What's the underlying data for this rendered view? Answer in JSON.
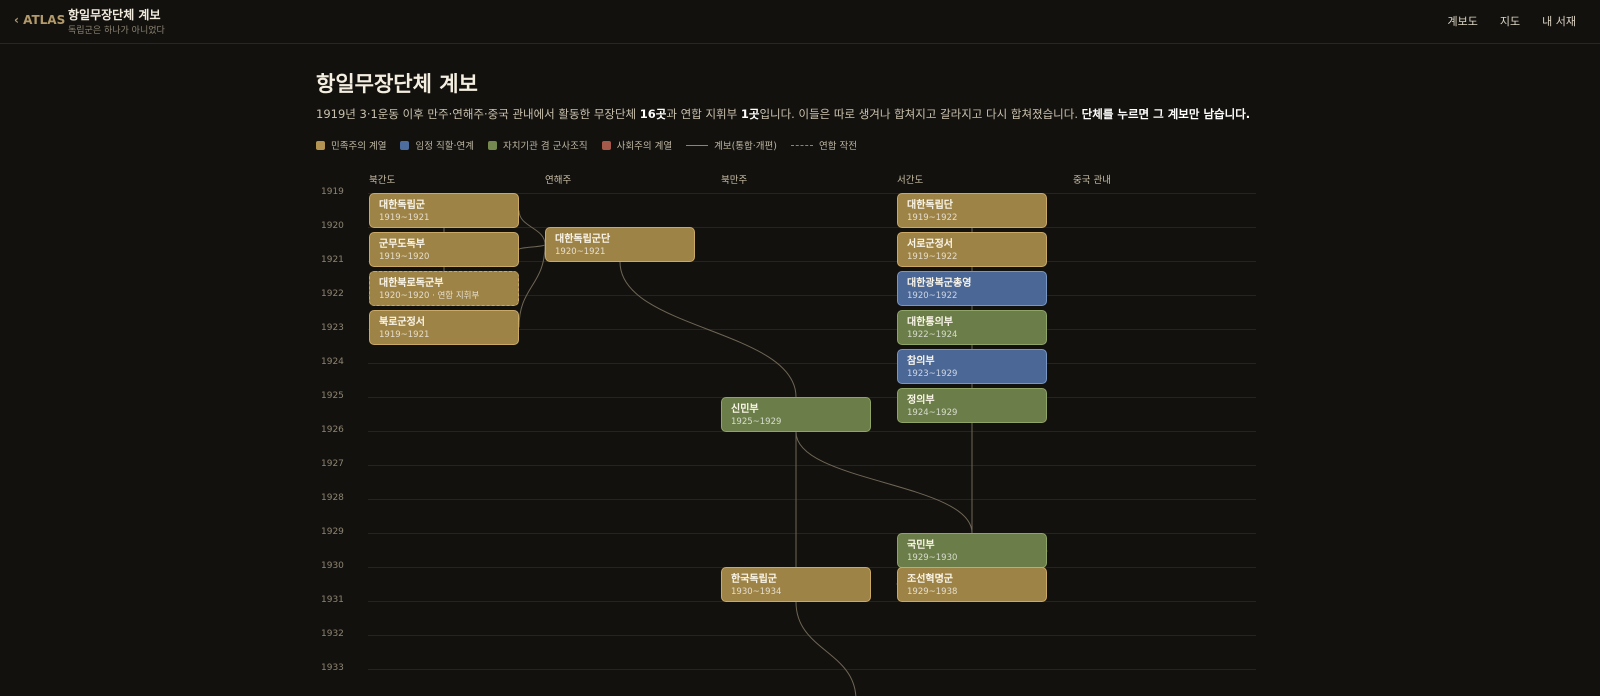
{
  "header": {
    "back_label": "‹ ATLAS",
    "title": "항일무장단체 계보",
    "subtitle": "독립군은 하나가 아니었다",
    "nav": [
      "계보도",
      "지도",
      "내 서재"
    ]
  },
  "page": {
    "title": "항일무장단체 계보",
    "intro_a": "1919년 3·1운동 이후 만주·연해주·중국 관내에서 활동한 무장단체 ",
    "intro_b": "16곳",
    "intro_c": "과 연합 지휘부 ",
    "intro_d": "1곳",
    "intro_e": "입니다. 이들은 따로 생겨나 합쳐지고 갈라지고 다시 합쳐졌습니다. ",
    "intro_f": "단체를 누르면 그 계보만 남습니다."
  },
  "legend": [
    {
      "label": "민족주의 계열",
      "color": "#b39352"
    },
    {
      "label": "임정 직할·연계",
      "color": "#4d6d9e"
    },
    {
      "label": "자치기관 겸 군사조직",
      "color": "#74884f"
    },
    {
      "label": "사회주의 계열",
      "color": "#a4594a"
    }
  ],
  "legend_lines": {
    "solid": "계보(통합·개편)",
    "dashed": "연합 작전"
  },
  "columns": [
    "북간도",
    "연해주",
    "북만주",
    "서간도",
    "중국 관내"
  ],
  "years": [
    "1919",
    "1920",
    "1921",
    "1922",
    "1923",
    "1924",
    "1925",
    "1926",
    "1927",
    "1928",
    "1929",
    "1930",
    "1931",
    "1932",
    "1933"
  ],
  "colors": {
    "nationalist": {
      "fill": "#9e8347",
      "border": "#c9a868"
    },
    "provisional": {
      "fill": "#4a6796",
      "border": "#7896c4"
    },
    "autonomous": {
      "fill": "#6b7d48",
      "border": "#8fa466"
    }
  },
  "nodes": [
    {
      "id": "n1",
      "name": "대한독립군",
      "years": "1919~1921",
      "column": 0,
      "year": 1919,
      "type": "nationalist"
    },
    {
      "id": "n2",
      "name": "군무도독부",
      "years": "1919~1920",
      "column": 0,
      "year": 1920,
      "type": "nationalist"
    },
    {
      "id": "n3",
      "name": "대한북로독군부",
      "years": "1920~1920 · 연합 지휘부",
      "column": 0,
      "year": 1921,
      "type": "nationalist",
      "dashed": true
    },
    {
      "id": "n4",
      "name": "북로군정서",
      "years": "1919~1921",
      "column": 0,
      "year": 1922,
      "type": "nationalist"
    },
    {
      "id": "n5",
      "name": "대한독립군단",
      "years": "1920~1921",
      "column": 1,
      "year": 1920,
      "type": "nationalist"
    },
    {
      "id": "n6",
      "name": "신민부",
      "years": "1925~1929",
      "column": 2,
      "year": 1925,
      "type": "autonomous"
    },
    {
      "id": "n7",
      "name": "한국독립군",
      "years": "1930~1934",
      "column": 2,
      "year": 1930,
      "type": "nationalist"
    },
    {
      "id": "n8",
      "name": "대한독립단",
      "years": "1919~1922",
      "column": 3,
      "year": 1919,
      "type": "nationalist"
    },
    {
      "id": "n9",
      "name": "서로군정서",
      "years": "1919~1922",
      "column": 3,
      "year": 1920,
      "type": "nationalist"
    },
    {
      "id": "n10",
      "name": "대한광복군총영",
      "years": "1920~1922",
      "column": 3,
      "year": 1921,
      "type": "provisional"
    },
    {
      "id": "n11",
      "name": "대한통의부",
      "years": "1922~1924",
      "column": 3,
      "year": 1922,
      "type": "autonomous"
    },
    {
      "id": "n12",
      "name": "참의부",
      "years": "1923~1929",
      "column": 3,
      "year": 1923,
      "type": "provisional"
    },
    {
      "id": "n13",
      "name": "정의부",
      "years": "1924~1929",
      "column": 3,
      "year": 1924,
      "type": "autonomous"
    },
    {
      "id": "n14",
      "name": "국민부",
      "years": "1929~1930",
      "column": 3,
      "year": 1929,
      "type": "autonomous"
    },
    {
      "id": "n15",
      "name": "조선혁명군",
      "years": "1929~1938",
      "column": 3,
      "year": 1930,
      "type": "nationalist"
    }
  ],
  "links": [
    {
      "from": "n1",
      "to": "n5",
      "kind": "lineage"
    },
    {
      "from": "n2",
      "to": "n5",
      "kind": "lineage"
    },
    {
      "from": "n4",
      "to": "n5",
      "kind": "lineage"
    },
    {
      "from": "n1",
      "to": "n3",
      "kind": "lineage"
    },
    {
      "from": "n5",
      "to": "n6",
      "kind": "lineage"
    },
    {
      "from": "n6",
      "to": "n14",
      "kind": "lineage"
    },
    {
      "from": "n6",
      "to": "n7",
      "kind": "lineage"
    },
    {
      "from": "n8",
      "to": "n14",
      "kind": "lineage"
    },
    {
      "from": "n14",
      "to": "n15",
      "kind": "lineage"
    },
    {
      "from": "n7",
      "to": "offpage",
      "kind": "lineage"
    }
  ]
}
